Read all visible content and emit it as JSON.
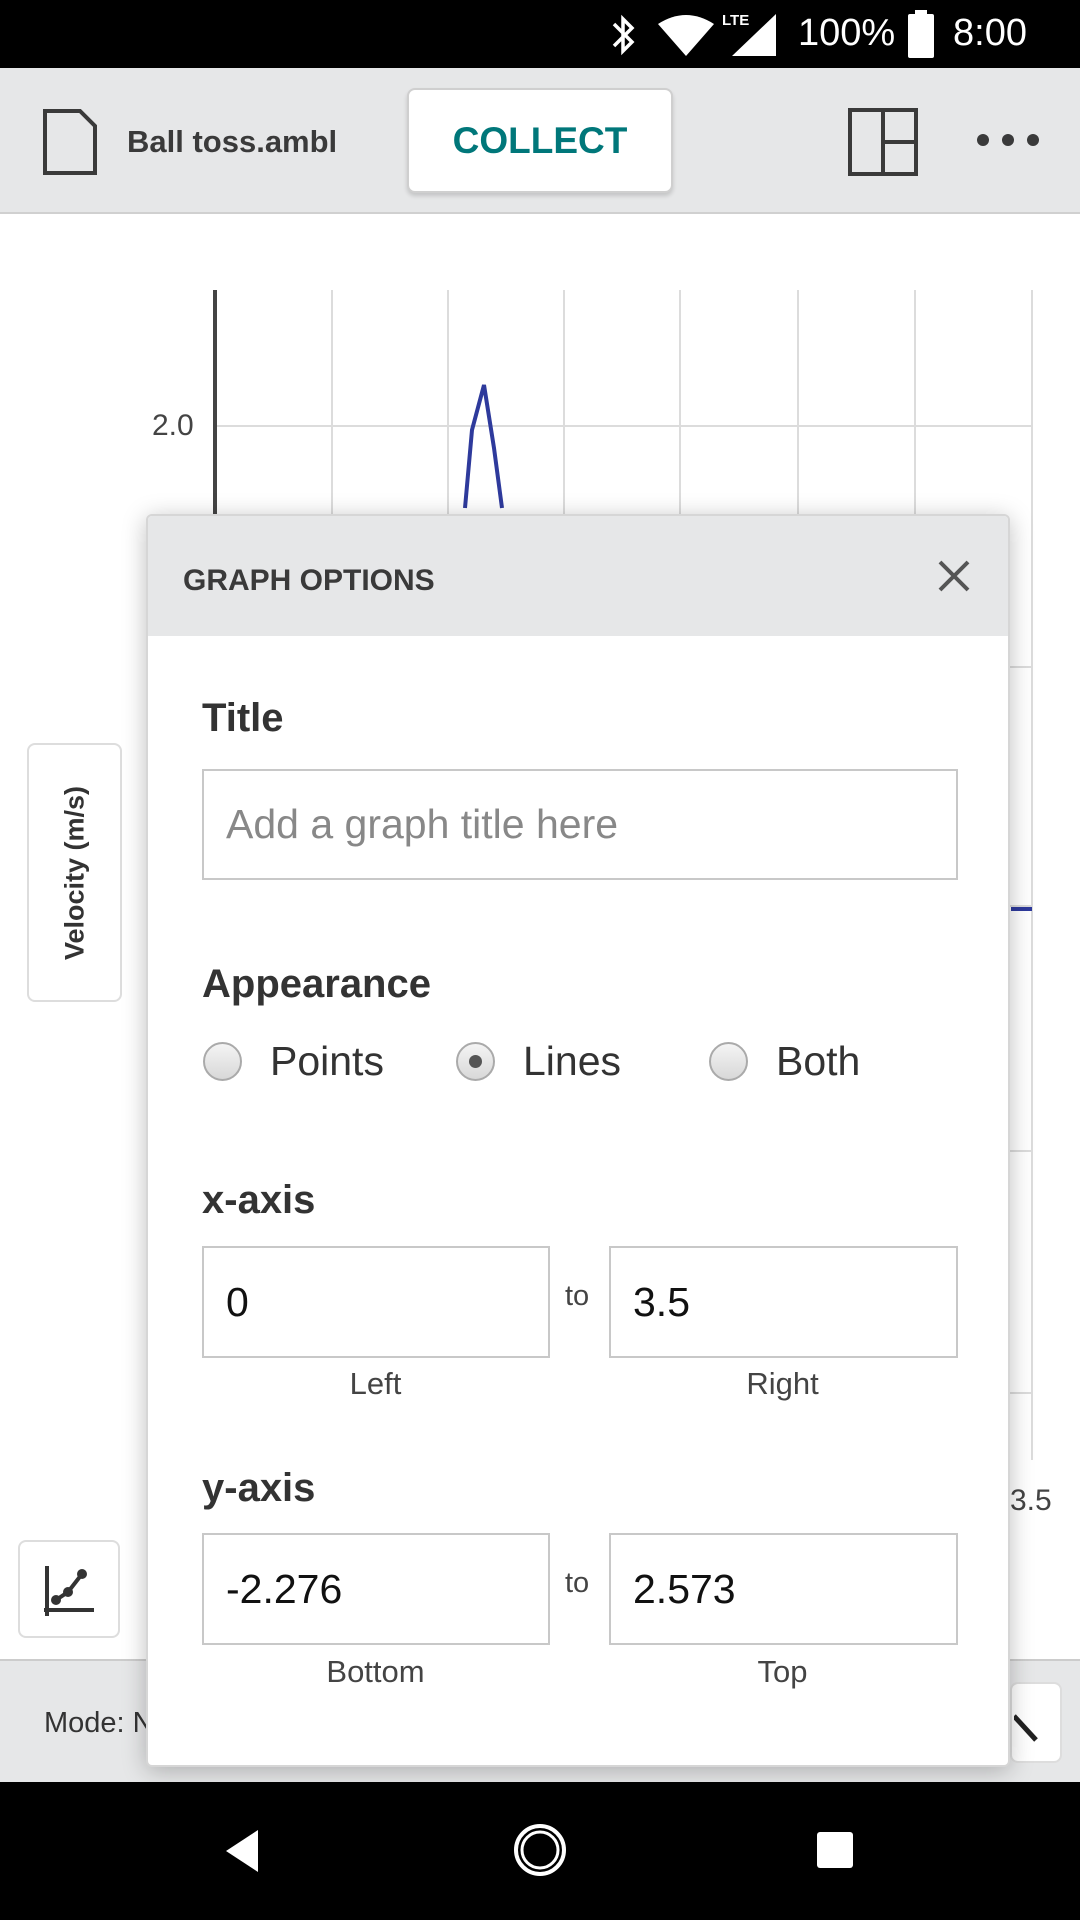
{
  "status_bar": {
    "battery": "100%",
    "time": "8:00",
    "network": "LTE",
    "icons": [
      "bluetooth-icon",
      "wifi-icon",
      "signal-icon",
      "battery-icon"
    ]
  },
  "header": {
    "file_name": "Ball toss.ambl",
    "collect_label": "COLLECT",
    "icons": [
      "file-icon",
      "layout-icon",
      "more-icon"
    ]
  },
  "graph": {
    "y_tick_label": "2.0",
    "x_tick_label": "3.5",
    "y_axis_label": "Velocity (m/s)",
    "line_color": "#2e3a9c"
  },
  "bottom_bar": {
    "mode_text": "Mode: N"
  },
  "dialog": {
    "title": "GRAPH OPTIONS",
    "title_label": "Title",
    "title_placeholder": "Add a graph title here",
    "title_value": "",
    "appearance_label": "Appearance",
    "appearance_options": [
      "Points",
      "Lines",
      "Both"
    ],
    "appearance_selected": "Lines",
    "x_axis": {
      "label": "x-axis",
      "left": "0",
      "right": "3.5",
      "left_caption": "Left",
      "right_caption": "Right",
      "to": "to"
    },
    "y_axis": {
      "label": "y-axis",
      "bottom": "-2.276",
      "top": "2.573",
      "bottom_caption": "Bottom",
      "top_caption": "Top",
      "to": "to"
    }
  },
  "accent_color": "#00777a"
}
